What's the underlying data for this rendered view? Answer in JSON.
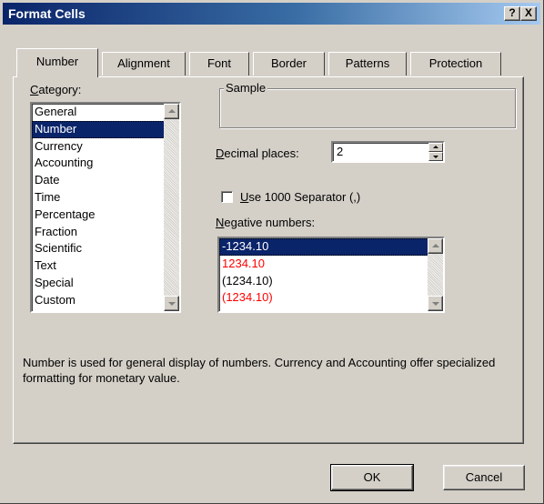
{
  "window": {
    "title": "Format Cells",
    "help_label": "?",
    "close_label": "X"
  },
  "tabs": [
    {
      "label": "Number",
      "active": true
    },
    {
      "label": "Alignment"
    },
    {
      "label": "Font"
    },
    {
      "label": "Border"
    },
    {
      "label": "Patterns"
    },
    {
      "label": "Protection"
    }
  ],
  "category": {
    "label_hot": "C",
    "label_rest": "ategory:",
    "items": [
      "General",
      "Number",
      "Currency",
      "Accounting",
      "Date",
      "Time",
      "Percentage",
      "Fraction",
      "Scientific",
      "Text",
      "Special",
      "Custom"
    ],
    "selected": "Number"
  },
  "sample": {
    "title": "Sample"
  },
  "decimal_places": {
    "label_hot": "D",
    "label_rest": "ecimal places:",
    "value": "2"
  },
  "separator": {
    "label_hot": "U",
    "label_rest": "se 1000 Separator (,)",
    "checked": false
  },
  "negative_numbers": {
    "label_hot": "N",
    "label_rest": "egative numbers:",
    "items": [
      {
        "text": "-1234.10",
        "color": "#000000",
        "selected": true
      },
      {
        "text": "1234.10",
        "color": "#ff0000"
      },
      {
        "text": "(1234.10)",
        "color": "#000000"
      },
      {
        "text": "(1234.10)",
        "color": "#ff0000"
      }
    ]
  },
  "description": "Number is used for general display of numbers.  Currency and Accounting offer specialized formatting for monetary value.",
  "buttons": {
    "ok": "OK",
    "cancel": "Cancel"
  }
}
